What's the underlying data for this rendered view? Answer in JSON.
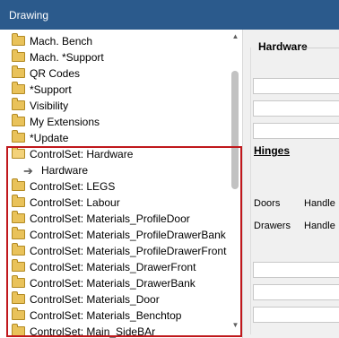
{
  "window": {
    "title": "Drawing"
  },
  "tree": {
    "items": [
      {
        "label": "Mach. Bench",
        "icon": "folder-icon",
        "level": 0
      },
      {
        "label": "Mach. *Support",
        "icon": "folder-icon",
        "level": 0
      },
      {
        "label": "QR Codes",
        "icon": "folder-icon",
        "level": 0
      },
      {
        "label": "*Support",
        "icon": "folder-icon",
        "level": 0
      },
      {
        "label": "Visibility",
        "icon": "folder-icon",
        "level": 0
      },
      {
        "label": "My Extensions",
        "icon": "folder-icon",
        "level": 0
      },
      {
        "label": "*Update",
        "icon": "folder-icon",
        "level": 0
      },
      {
        "label": "ControlSet: Hardware",
        "icon": "folder-open-icon",
        "level": 0
      },
      {
        "label": "Hardware",
        "icon": "arrow-right-icon",
        "level": 1
      },
      {
        "label": "ControlSet: LEGS",
        "icon": "folder-icon",
        "level": 0
      },
      {
        "label": "ControlSet: Labour",
        "icon": "folder-icon",
        "level": 0
      },
      {
        "label": "ControlSet: Materials_ProfileDoor",
        "icon": "folder-icon",
        "level": 0
      },
      {
        "label": "ControlSet: Materials_ProfileDrawerBank",
        "icon": "folder-icon",
        "level": 0
      },
      {
        "label": "ControlSet: Materials_ProfileDrawerFront",
        "icon": "folder-icon",
        "level": 0
      },
      {
        "label": "ControlSet: Materials_DrawerFront",
        "icon": "folder-icon",
        "level": 0
      },
      {
        "label": "ControlSet: Materials_DrawerBank",
        "icon": "folder-icon",
        "level": 0
      },
      {
        "label": "ControlSet: Materials_Door",
        "icon": "folder-icon",
        "level": 0
      },
      {
        "label": "ControlSet: Materials_Benchtop",
        "icon": "folder-icon",
        "level": 0
      },
      {
        "label": "ControlSet: Main_SideBAr",
        "icon": "folder-icon",
        "level": 0
      }
    ]
  },
  "panel": {
    "title": "Hardware",
    "hinges_label": "Hinges",
    "doors_label": "Doors",
    "drawers_label": "Drawers",
    "handle_label_1": "Handle",
    "handle_label_2": "Handle"
  },
  "colors": {
    "titlebar": "#2b5a8c",
    "highlight_border": "#c0181c",
    "folder": "#e9c25a"
  }
}
